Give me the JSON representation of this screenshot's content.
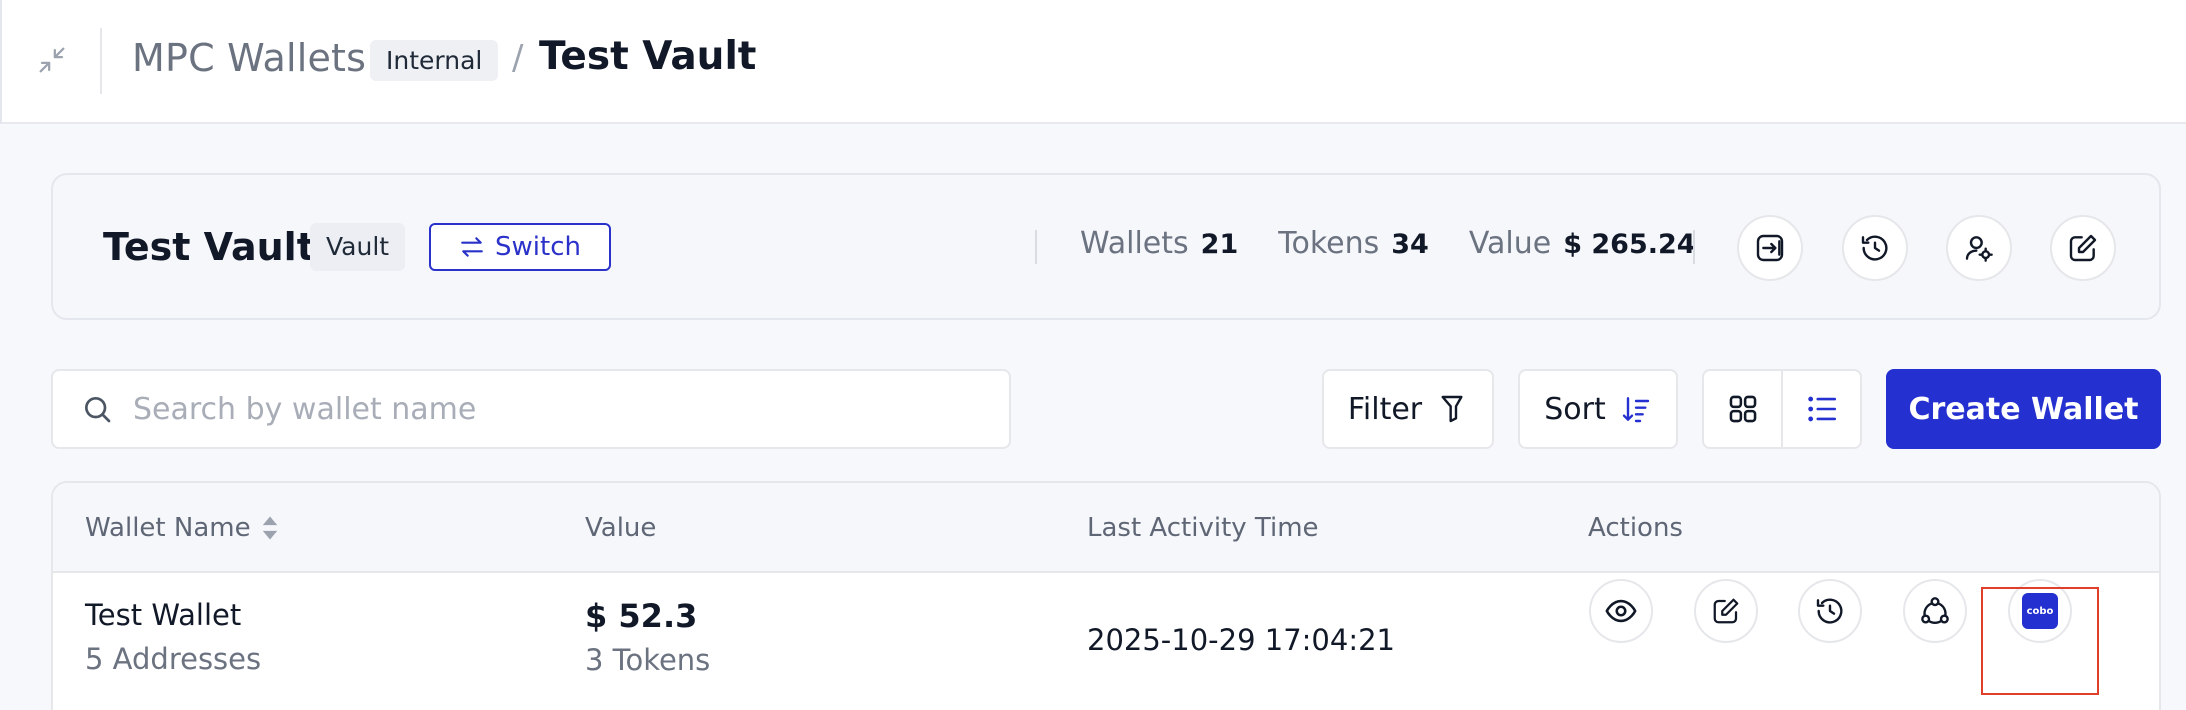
{
  "header": {
    "breadcrumb_parent": "MPC Wallets",
    "breadcrumb_tag": "Internal",
    "breadcrumb_separator": "/",
    "breadcrumb_current": "Test Vault",
    "icons": {
      "collapse": "minimize-arrows-icon"
    }
  },
  "vault": {
    "title": "Test Vault",
    "tag": "Vault",
    "switch_label": "Switch",
    "stats": {
      "wallets_label": "Wallets",
      "wallets_value": "21",
      "tokens_label": "Tokens",
      "tokens_value": "34",
      "value_label": "Value",
      "value_value": "$ 265.24"
    },
    "action_icons": [
      "transfer-in-icon",
      "history-icon",
      "user-settings-icon",
      "edit-icon"
    ]
  },
  "toolbar": {
    "search_placeholder": "Search by wallet name",
    "search_value": "",
    "filter_label": "Filter",
    "sort_label": "Sort",
    "view_modes": [
      "grid-view-icon",
      "list-view-icon"
    ],
    "active_view": "list",
    "create_label": "Create Wallet"
  },
  "table": {
    "columns": [
      "Wallet Name",
      "Value",
      "Last Activity Time",
      "Actions"
    ],
    "rows": [
      {
        "name": "Test Wallet",
        "addresses": "5 Addresses",
        "value": "$ 52.3",
        "tokens": "3 Tokens",
        "last_activity": "2025-10-29 17:04:21",
        "action_icons": [
          "view-icon",
          "edit-icon",
          "history-icon",
          "share-nodes-icon",
          "cobo-logo-icon"
        ],
        "cobo_label": "cobo"
      }
    ]
  },
  "colors": {
    "accent": "#2430cf",
    "highlight_border": "#e0402b",
    "background": "#f7f8fb"
  }
}
